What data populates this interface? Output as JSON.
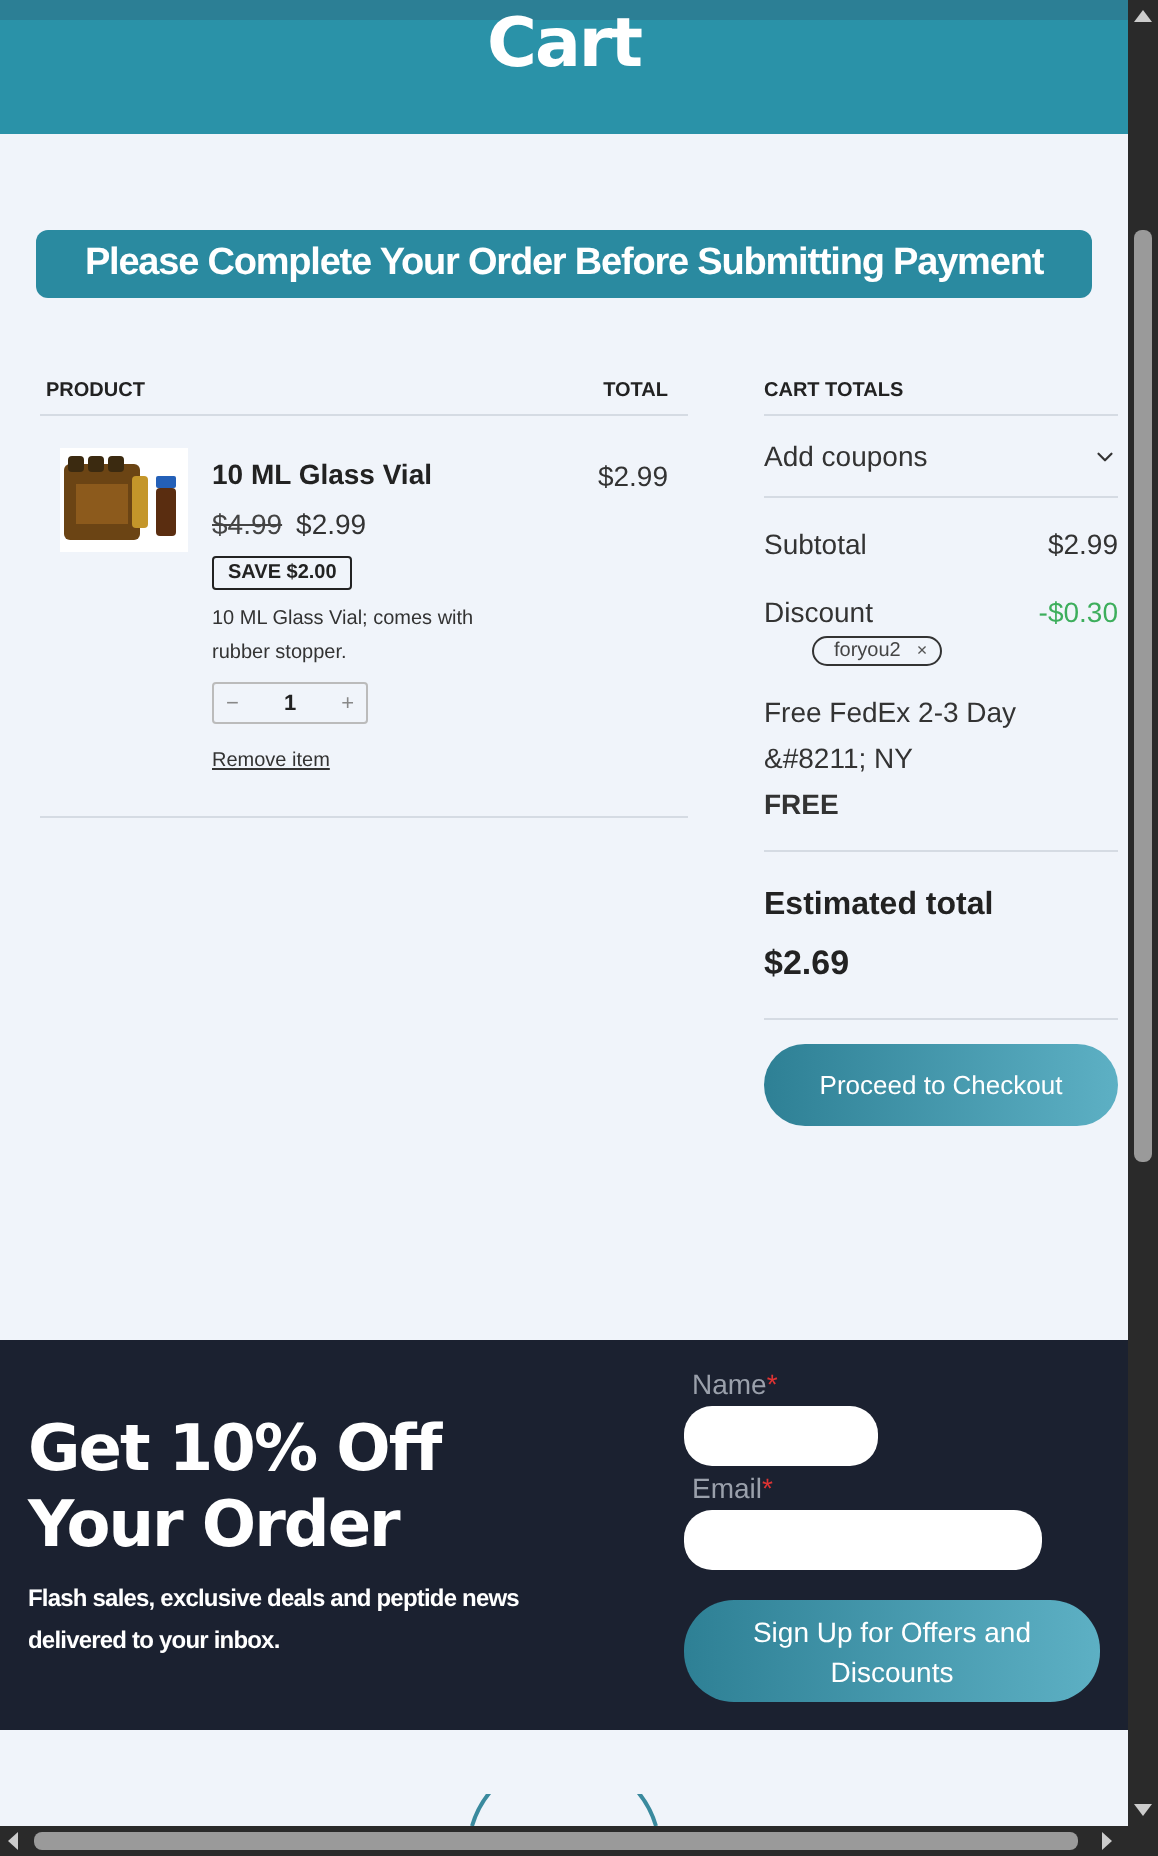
{
  "header": {
    "title": "Cart"
  },
  "notice": "Please Complete Your Order Before Submitting Payment",
  "cart_table": {
    "columns": [
      "PRODUCT",
      "TOTAL"
    ],
    "items": [
      {
        "name": "10 ML Glass Vial",
        "regular_price": "$4.99",
        "sale_price": "$2.99",
        "badge": "SAVE $2.00",
        "description": "10 ML Glass Vial; comes with rubber stopper.",
        "decrement": "−",
        "quantity": "1",
        "increment": "+",
        "remove": "Remove item",
        "total": "$2.99"
      }
    ]
  },
  "cart_totals": {
    "heading": "CART TOTALS",
    "coupons": {
      "label": "Add coupons",
      "expanded": false
    },
    "rows": [
      {
        "kind": "line",
        "label": "Subtotal",
        "value": "$2.99"
      },
      {
        "kind": "discount",
        "label": "Discount",
        "value": "-$0.30",
        "coupon": "foryou2",
        "coupon_remove": "×"
      },
      {
        "kind": "shipping",
        "label": "Free FedEx 2-3 Day &#8211; NY",
        "value": "FREE"
      }
    ],
    "estimated": {
      "label": "Estimated total",
      "value": "$2.69"
    },
    "checkout": "Proceed to Checkout"
  },
  "signup": {
    "title": "Get 10% Off Your Order",
    "text": "Flash sales, exclusive deals and peptide news delivered to your inbox.",
    "fields": [
      {
        "label": "Name",
        "required_mark": "*"
      },
      {
        "label": "Email",
        "required_mark": "*"
      }
    ],
    "button": "Sign Up for Offers and Discounts"
  }
}
